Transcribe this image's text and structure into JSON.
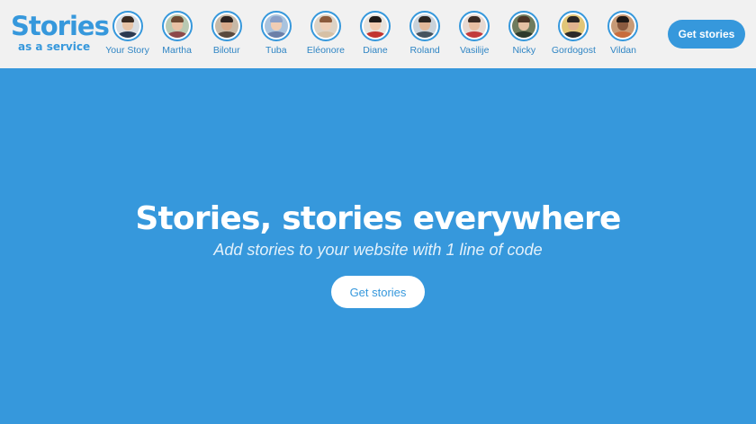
{
  "brand": {
    "name": "Stories",
    "tagline": "as a service",
    "color": "#3698dc"
  },
  "header": {
    "stories": [
      {
        "label": "Your Story",
        "bg": "#d9dde2",
        "skin": "#e7c3a6",
        "hair": "#3a2b22",
        "shirt": "#2b3a52"
      },
      {
        "label": "Martha",
        "bg": "#b9c9b2",
        "skin": "#e9c1a4",
        "hair": "#6d4a33",
        "shirt": "#8c4a4a"
      },
      {
        "label": "Bilotur",
        "bg": "#c7b9a7",
        "skin": "#d8a98a",
        "hair": "#2d2320",
        "shirt": "#5a4a3e"
      },
      {
        "label": "Tuba",
        "bg": "#a9c3de",
        "skin": "#f0cdb4",
        "hair": "#8aa0c8",
        "shirt": "#6c7fa8"
      },
      {
        "label": "Eléonore",
        "bg": "#ddd3c6",
        "skin": "#efcfb8",
        "hair": "#8b5a3c",
        "shirt": "#d6c0a5"
      },
      {
        "label": "Diane",
        "bg": "#e7e3dd",
        "skin": "#f1cbb0",
        "hair": "#1f1a18",
        "shirt": "#c2352f"
      },
      {
        "label": "Roland",
        "bg": "#c9d2da",
        "skin": "#e2b89a",
        "hair": "#2b2522",
        "shirt": "#46535f"
      },
      {
        "label": "Vasilije",
        "bg": "#e7d9d2",
        "skin": "#e8bfa3",
        "hair": "#3b2b24",
        "shirt": "#c23b3b"
      },
      {
        "label": "Nicky",
        "bg": "#6f7c5e",
        "skin": "#e5c0a3",
        "hair": "#4b3526",
        "shirt": "#2d3a2c"
      },
      {
        "label": "Gordogost",
        "bg": "#e1c678",
        "skin": "#e0b38f",
        "hair": "#2a2624",
        "shirt": "#2d2a28"
      },
      {
        "label": "Vildan",
        "bg": "#c79a76",
        "skin": "#8a5a3f",
        "hair": "#1e1815",
        "shirt": "#c86c3c"
      }
    ],
    "cta_label": "Get stories"
  },
  "hero": {
    "title": "Stories, stories everywhere",
    "subtitle": "Add stories to your website with 1 line of code",
    "cta_label": "Get stories",
    "bg": "#3698dc"
  }
}
